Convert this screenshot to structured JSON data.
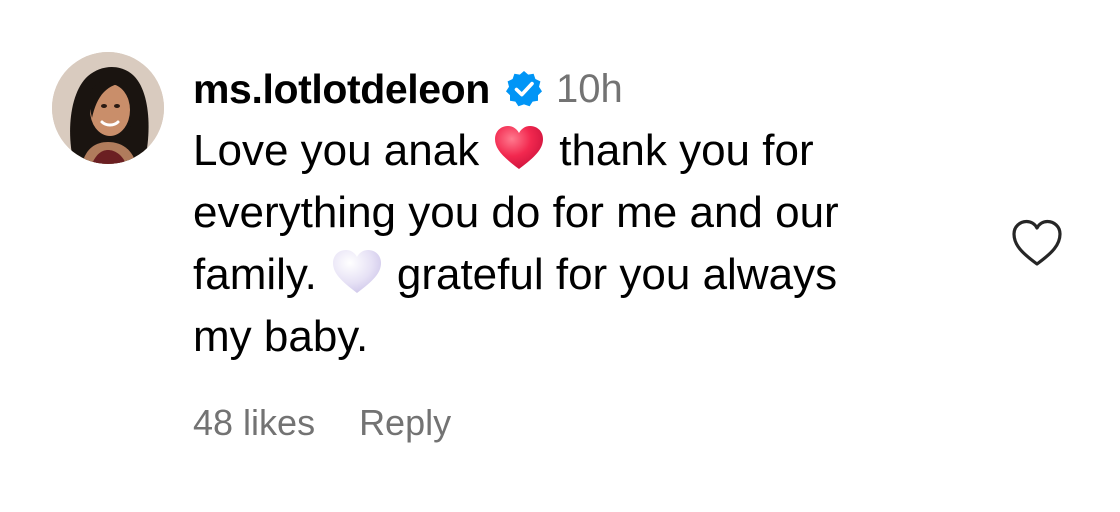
{
  "comment": {
    "username": "ms.lotlotdeleon",
    "verified": true,
    "timestamp": "10h",
    "text_lines": [
      {
        "before": "Love you anak",
        "emoji": "red-heart",
        "after": "thank you for"
      },
      {
        "text": "everything you do for me and our"
      },
      {
        "before": "family.",
        "emoji": "white-heart",
        "after": "grateful for you always"
      },
      {
        "text": "my baby."
      }
    ],
    "likes": "48 likes",
    "reply_label": "Reply"
  },
  "icons": {
    "verified": "verified-badge-icon",
    "like": "heart-outline-icon",
    "emoji_1": "red-heart-emoji",
    "emoji_2": "white-heart-emoji"
  },
  "colors": {
    "verified_blue": "#0095F6",
    "secondary_text": "#737373",
    "red_heart": "#F2284F",
    "white_heart": "#DDD8F0"
  }
}
